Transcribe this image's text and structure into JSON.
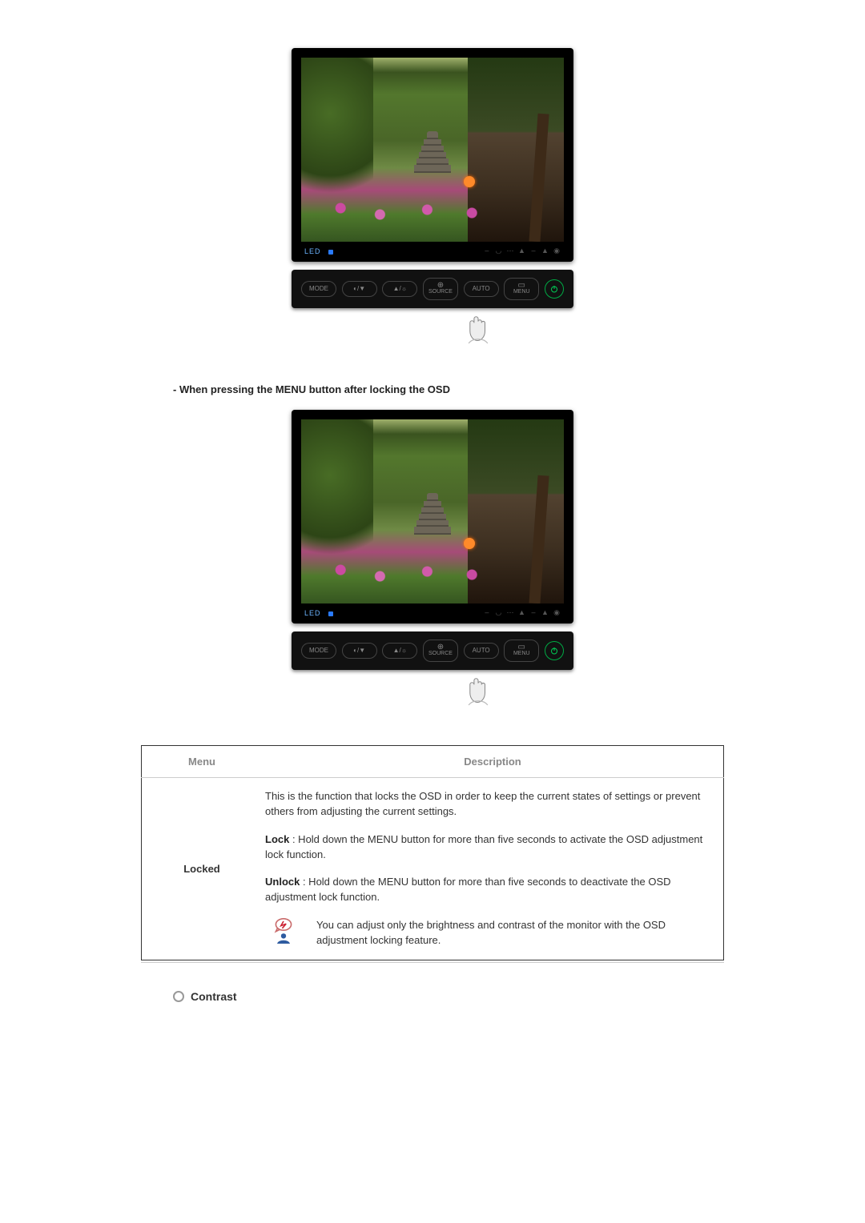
{
  "monitor": {
    "led_label": "LED",
    "chin_icons": [
      "–",
      "◡",
      "⋯",
      "▲",
      "–",
      "▲",
      "◉"
    ],
    "buttons": {
      "mode": "MODE",
      "contrast_vol": "◐/▼",
      "bright_up": "▲/☼",
      "source_icon": "⊕",
      "source_label": "SOURCE",
      "auto": "AUTO",
      "menu_icon": "▭",
      "menu_label": "MENU"
    }
  },
  "section_heading": "- When pressing the MENU button after locking the OSD",
  "table": {
    "col_menu": "Menu",
    "col_desc": "Description",
    "row_label": "Locked",
    "desc_intro": "This is the function that locks the OSD in order to keep the current states of settings or prevent others from adjusting the current settings.",
    "lock_label": "Lock",
    "lock_text": " : Hold down the MENU button for more than five seconds to activate the OSD adjustment lock function.",
    "unlock_label": "Unlock",
    "unlock_text": " : Hold down the MENU button for more than five seconds to deactivate the OSD adjustment lock function.",
    "tip_text": "You can adjust only the brightness and contrast of the monitor with the OSD adjustment locking feature."
  },
  "contrast_heading": "Contrast"
}
